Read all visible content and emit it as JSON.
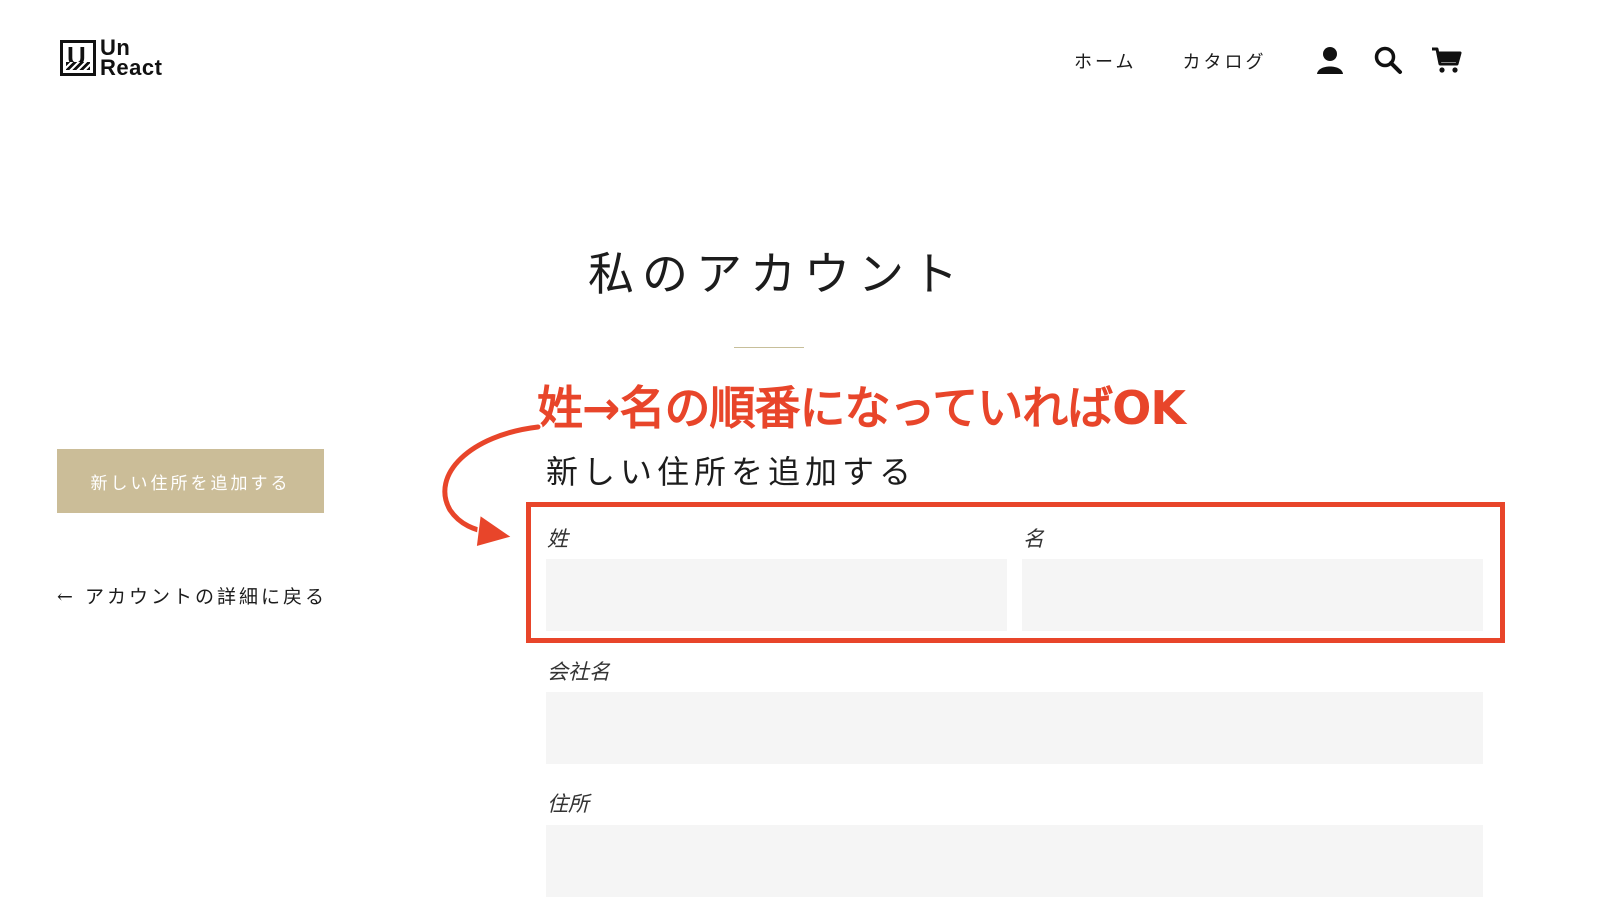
{
  "header": {
    "logo_text": "Un React",
    "logo_text_line1": "Un",
    "logo_text_line2": "React",
    "logo_letter": "U",
    "nav": {
      "home": "ホーム",
      "catalog": "カタログ"
    },
    "icons": [
      "account-icon",
      "search-icon",
      "cart-icon"
    ]
  },
  "page": {
    "title": "私のアカウント"
  },
  "sidebar": {
    "add_address_button": "新しい住所を追加する",
    "back_link": "← アカウントの詳細に戻る"
  },
  "form": {
    "title": "新しい住所を追加する",
    "fields": {
      "last_name": {
        "label": "姓",
        "value": ""
      },
      "first_name": {
        "label": "名",
        "value": ""
      },
      "company": {
        "label": "会社名",
        "value": ""
      },
      "address": {
        "label": "住所",
        "value": ""
      }
    }
  },
  "annotation": {
    "text": "姓→名の順番になっていればOK",
    "color": "#e8452a"
  },
  "colors": {
    "accent": "#cbbd98",
    "text": "#1c1c1c",
    "input_bg": "#f5f5f5"
  }
}
